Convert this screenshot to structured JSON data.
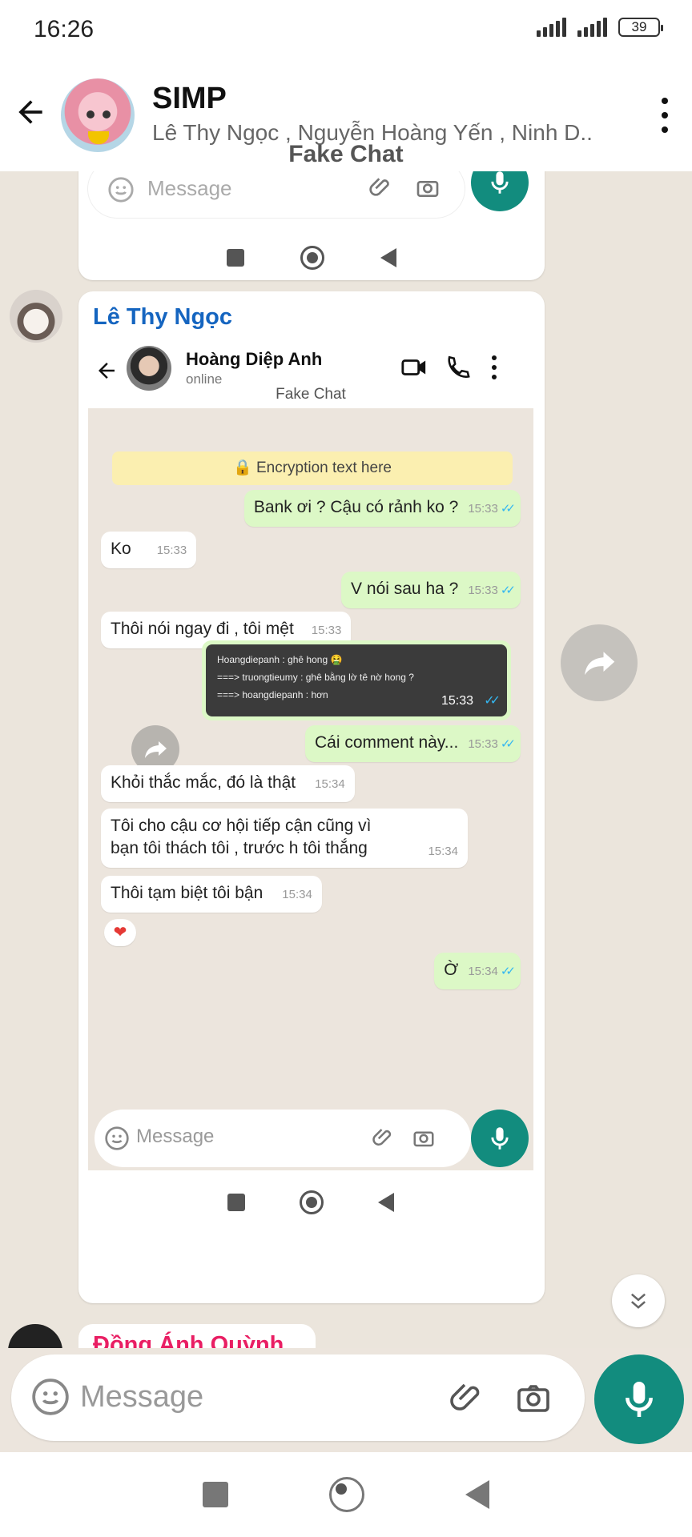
{
  "status_bar": {
    "time": "16:26",
    "battery": "39"
  },
  "header": {
    "title": "SIMP",
    "subtitle": "Lê Thy Ngọc , Nguyễn Hoàng Yến , Ninh D..",
    "watermark": "Fake Chat"
  },
  "prev_card": {
    "input_placeholder": "Message"
  },
  "main_card": {
    "sender": "Lê Thy Ngọc",
    "inner": {
      "contact_name": "Hoàng Diệp Anh",
      "contact_status": "online",
      "watermark": "Fake Chat",
      "encryption_text": "Encryption text here",
      "input_placeholder": "Message",
      "messages": [
        {
          "dir": "out",
          "text": "Bank ơi ? Cậu có rảnh ko ?",
          "time": "15:33"
        },
        {
          "dir": "in",
          "text": "Ko",
          "time": "15:33"
        },
        {
          "dir": "out",
          "text": "V nói sau ha ?",
          "time": "15:33"
        },
        {
          "dir": "in",
          "text": "Thôi nói ngay đi , tôi mệt",
          "time": "15:33"
        },
        {
          "dir": "out",
          "text": "Cái comment này...",
          "time": "15:33"
        },
        {
          "dir": "in",
          "text": "Khỏi thắc mắc, đó là thật",
          "time": "15:34"
        },
        {
          "dir": "in",
          "text": "Tôi cho cậu cơ hội tiếp cận cũng vì bạn tôi thách  tôi , trước h tôi thắng",
          "time": "15:34"
        },
        {
          "dir": "in",
          "text": "Thôi tạm biệt tôi bận",
          "time": "15:34"
        },
        {
          "dir": "out",
          "text": "Ờ",
          "time": "15:34"
        }
      ],
      "image_message": {
        "lines": [
          "Hoangdiepanh : ghê hong 🤮",
          "===> truongtieumy : ghê bằng lờ tê nờ hong ?",
          "===> hoangdiepanh : hơn"
        ],
        "time": "15:33"
      },
      "reaction": "❤"
    }
  },
  "next_card": {
    "sender": "Đồng Ánh Quỳnh"
  },
  "input": {
    "placeholder": "Message"
  },
  "colors": {
    "accent": "#128c7e",
    "outgoing": "#dcf8c6",
    "sender_blue": "#1565c0"
  }
}
